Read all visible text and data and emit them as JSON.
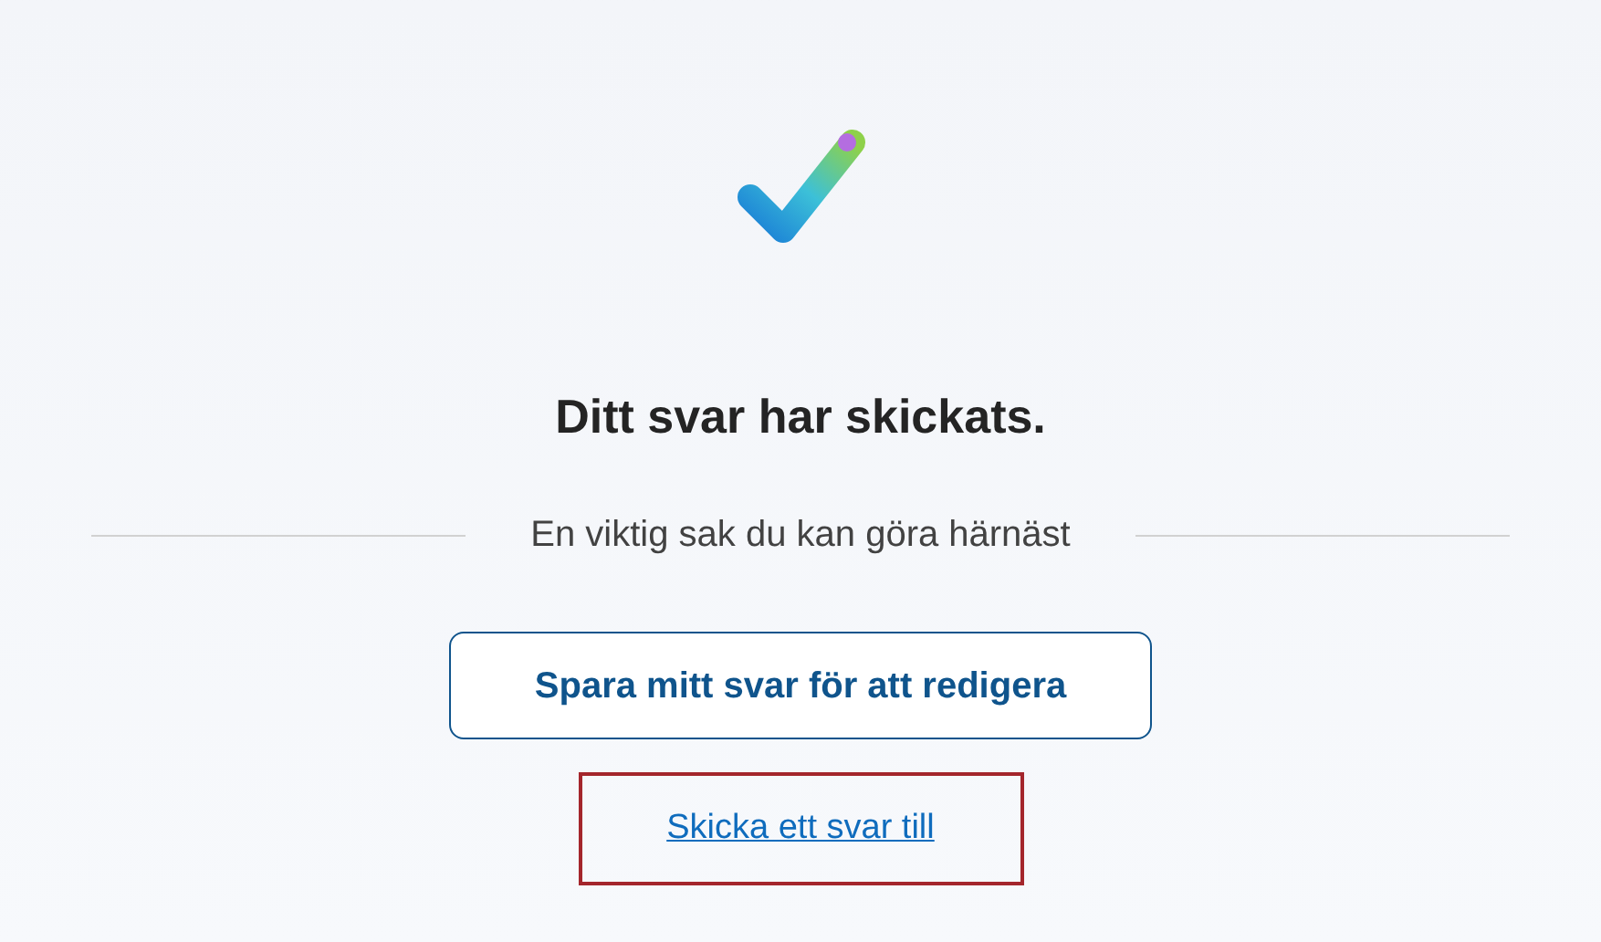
{
  "title": "Ditt svar har skickats.",
  "divider_text": "En viktig sak du kan göra härnäst",
  "save_button": {
    "label": "Spara mitt svar för att redigera"
  },
  "link": {
    "label": "Skicka ett svar till",
    "focused": true
  }
}
